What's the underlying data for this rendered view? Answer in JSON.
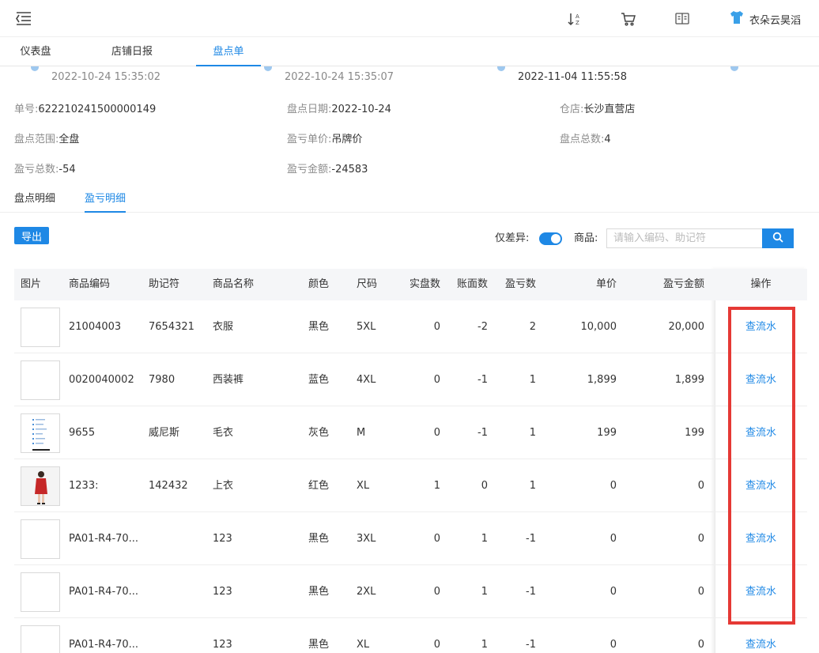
{
  "header": {
    "user_name": "衣朵云昊滔"
  },
  "tabs": [
    "仪表盘",
    "店铺日报",
    "盘点单"
  ],
  "timeline": [
    "2022-10-24 15:35:02",
    "2022-10-24 15:35:07",
    "2022-11-04 11:55:58"
  ],
  "info": {
    "order_no_label": "单号:",
    "order_no": "622210241500000149",
    "date_label": "盘点日期:",
    "date": "2022-10-24",
    "store_label": "仓店:",
    "store": "长沙直营店",
    "scope_label": "盘点范围:",
    "scope": "全盘",
    "price_label": "盈亏单价:",
    "price": "吊牌价",
    "total_label": "盘点总数:",
    "total": "4",
    "pl_total_label": "盈亏总数:",
    "pl_total": "-54",
    "pl_amount_label": "盈亏金额:",
    "pl_amount": "-24583"
  },
  "subtabs": [
    "盘点明细",
    "盈亏明细"
  ],
  "toolbar": {
    "export_label": "导出",
    "diff_only_label": "仅差异:",
    "diff_only_on": true,
    "goods_label": "商品:",
    "search_placeholder": "请输入编码、助记符"
  },
  "table": {
    "columns": [
      "图片",
      "商品编码",
      "助记符",
      "商品名称",
      "颜色",
      "尺码",
      "实盘数",
      "账面数",
      "盈亏数",
      "单价",
      "盈亏金额",
      "操作"
    ],
    "rows": [
      {
        "code": "21004003",
        "mnemonic": "7654321",
        "name": "衣服",
        "color": "黑色",
        "size": "5XL",
        "actual": "0",
        "book": "-2",
        "diff": "2",
        "unit_price": "10,000",
        "amount": "20,000",
        "action": "查流水",
        "image": "none"
      },
      {
        "code": "0020040002",
        "mnemonic": "7980",
        "name": "西装裤",
        "color": "蓝色",
        "size": "4XL",
        "actual": "0",
        "book": "-1",
        "diff": "1",
        "unit_price": "1,899",
        "amount": "1,899",
        "action": "查流水",
        "image": "none"
      },
      {
        "code": "9655",
        "mnemonic": "威尼斯",
        "name": "毛衣",
        "color": "灰色",
        "size": "M",
        "actual": "0",
        "book": "-1",
        "diff": "1",
        "unit_price": "199",
        "amount": "199",
        "action": "查流水",
        "image": "doc-thumbnail"
      },
      {
        "code": "1233:",
        "mnemonic": "142432",
        "name": "上衣",
        "color": "红色",
        "size": "XL",
        "actual": "1",
        "book": "0",
        "diff": "1",
        "unit_price": "0",
        "amount": "0",
        "action": "查流水",
        "image": "red-dress-photo"
      },
      {
        "code": "PA01-R4-70...",
        "mnemonic": "",
        "name": "123",
        "color": "黑色",
        "size": "3XL",
        "actual": "0",
        "book": "1",
        "diff": "-1",
        "unit_price": "0",
        "amount": "0",
        "action": "查流水",
        "image": "none"
      },
      {
        "code": "PA01-R4-70...",
        "mnemonic": "",
        "name": "123",
        "color": "黑色",
        "size": "2XL",
        "actual": "0",
        "book": "1",
        "diff": "-1",
        "unit_price": "0",
        "amount": "0",
        "action": "查流水",
        "image": "none"
      },
      {
        "code": "PA01-R4-70...",
        "mnemonic": "",
        "name": "123",
        "color": "黑色",
        "size": "XL",
        "actual": "0",
        "book": "1",
        "diff": "-1",
        "unit_price": "0",
        "amount": "0",
        "action": "查流水",
        "image": "none"
      }
    ]
  },
  "colors": {
    "accent": "#1e88e5",
    "highlight": "#e53935"
  }
}
